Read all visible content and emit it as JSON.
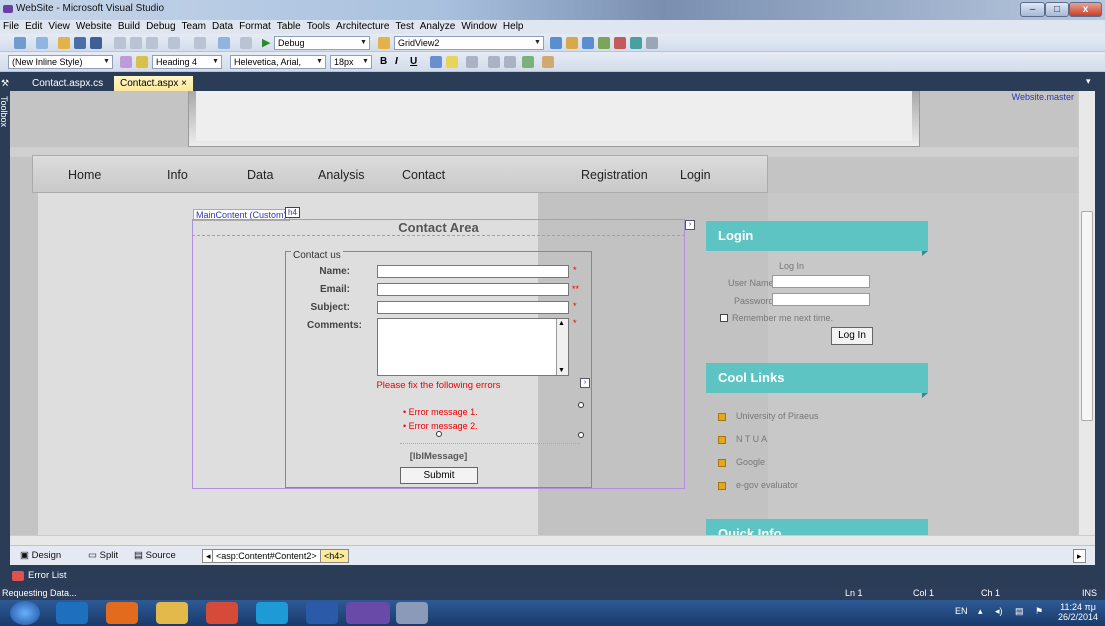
{
  "window": {
    "title": "WebSite - Microsoft Visual Studio",
    "min": "–",
    "max": "□",
    "close": "x"
  },
  "menu": [
    "File",
    "Edit",
    "View",
    "Website",
    "Build",
    "Debug",
    "Team",
    "Data",
    "Format",
    "Table",
    "Tools",
    "Architecture",
    "Test",
    "Analyze",
    "Window",
    "Help"
  ],
  "toolbar1": {
    "config": "Debug",
    "target": "GridView2"
  },
  "toolbar2": {
    "style": "(New Inline Style)",
    "block_format": "Heading 4",
    "font": "Helevetica, Arial,",
    "size": "18px",
    "bold": "B",
    "italic": "I",
    "underline": "U"
  },
  "toolbox_label": "Toolbox",
  "tabs": [
    {
      "label": "Contact.aspx.cs"
    },
    {
      "label": "Contact.aspx",
      "close": "×"
    }
  ],
  "master_link": "Website.master",
  "site": {
    "nav": [
      "Home",
      "Info",
      "Data",
      "Analysis",
      "Contact",
      "Registration",
      "Login"
    ],
    "maincontent_tag": "MainContent (Custom)",
    "h4_tag": "h4",
    "heading": "Contact Area",
    "legend": "Contact us",
    "fields": {
      "name": "Name:",
      "email": "Email:",
      "subject": "Subject:",
      "comments": "Comments:"
    },
    "asterisk": "*",
    "asterisk_double": "**",
    "error_header": "Please fix the following errors",
    "errors": [
      "Error message 1.",
      "Error message 2."
    ],
    "lbl_message": "[lblMessage]",
    "submit": "Submit",
    "login": {
      "title": "Login",
      "header": "Log In",
      "user_label": "User Name:",
      "password_label": "Password:",
      "remember": "Remember me next time.",
      "button": "Log In"
    },
    "cool_links": {
      "title": "Cool Links",
      "items": [
        "University of Piraeus",
        "N T U A",
        "Google",
        "e-gov evaluator"
      ]
    },
    "quick_info": {
      "title": "Quick Info"
    }
  },
  "viewbar": {
    "design": "Design",
    "split": "Split",
    "source": "Source",
    "crumbs": [
      "<asp:Content#Content2>",
      "<h4>"
    ]
  },
  "errorlist": "Error List",
  "status": {
    "message": "Requesting Data...",
    "ln": "Ln 1",
    "col": "Col 1",
    "ch": "Ch 1",
    "ins": "INS"
  },
  "tray": {
    "lang": "EN",
    "time": "11:24 πμ",
    "date": "26/2/2014"
  }
}
